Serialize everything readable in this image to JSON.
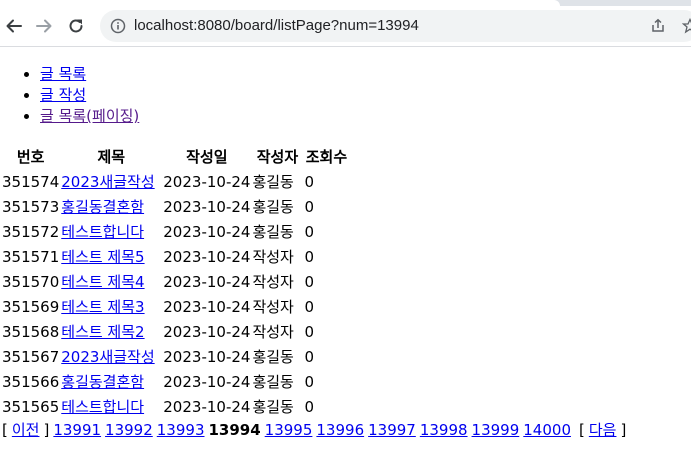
{
  "browser": {
    "url": "localhost:8080/board/listPage?num=13994"
  },
  "nav_links": [
    {
      "label": "글 목록"
    },
    {
      "label": "글 작성"
    },
    {
      "label": "글 목록(페이징)"
    }
  ],
  "table": {
    "headers": [
      "번호",
      "제목",
      "작성일",
      "작성자",
      "조회수"
    ],
    "rows": [
      {
        "no": "351574",
        "title": "2023새글작성",
        "date": "2023-10-24",
        "writer": "홍길동",
        "views": "0"
      },
      {
        "no": "351573",
        "title": "홍길동결혼함",
        "date": "2023-10-24",
        "writer": "홍길동",
        "views": "0"
      },
      {
        "no": "351572",
        "title": "테스트합니다",
        "date": "2023-10-24",
        "writer": "홍길동",
        "views": "0"
      },
      {
        "no": "351571",
        "title": "테스트 제목5",
        "date": "2023-10-24",
        "writer": "작성자",
        "views": "0"
      },
      {
        "no": "351570",
        "title": "테스트 제목4",
        "date": "2023-10-24",
        "writer": "작성자",
        "views": "0"
      },
      {
        "no": "351569",
        "title": "테스트 제목3",
        "date": "2023-10-24",
        "writer": "작성자",
        "views": "0"
      },
      {
        "no": "351568",
        "title": "테스트 제목2",
        "date": "2023-10-24",
        "writer": "작성자",
        "views": "0"
      },
      {
        "no": "351567",
        "title": "2023새글작성",
        "date": "2023-10-24",
        "writer": "홍길동",
        "views": "0"
      },
      {
        "no": "351566",
        "title": "홍길동결혼함",
        "date": "2023-10-24",
        "writer": "홍길동",
        "views": "0"
      },
      {
        "no": "351565",
        "title": "테스트합니다",
        "date": "2023-10-24",
        "writer": "홍길동",
        "views": "0"
      }
    ]
  },
  "pagination": {
    "open_bracket": "[",
    "close_bracket": "]",
    "prev_label": "이전",
    "next_label": "다음",
    "pages": [
      "13991",
      "13992",
      "13993",
      "13994",
      "13995",
      "13996",
      "13997",
      "13998",
      "13999",
      "14000"
    ],
    "current": "13994"
  }
}
